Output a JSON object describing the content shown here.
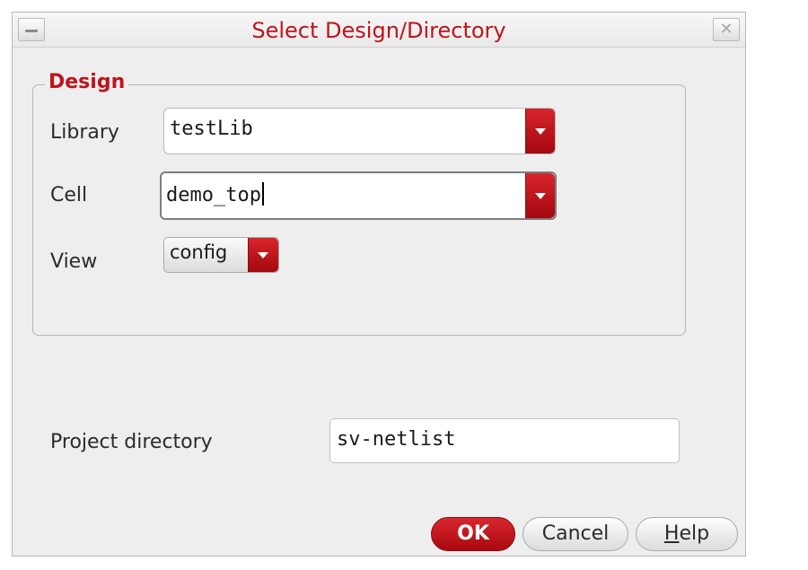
{
  "window": {
    "title": "Select Design/Directory",
    "close_glyph": "✕"
  },
  "design": {
    "group_label": "Design",
    "library": {
      "label": "Library",
      "value": "testLib"
    },
    "cell": {
      "label": "Cell",
      "value": "demo_top"
    },
    "view": {
      "label": "View",
      "value": "config"
    }
  },
  "project": {
    "label": "Project directory",
    "value": "sv-netlist"
  },
  "buttons": {
    "ok": "OK",
    "cancel": "Cancel",
    "help_mnemonic": "H",
    "help_rest": "elp"
  },
  "colors": {
    "accent": "#c0141b",
    "dialog_bg": "#eeeeee"
  },
  "icons": [
    "minimize-icon",
    "close-icon",
    "dropdown-arrow-icon"
  ]
}
